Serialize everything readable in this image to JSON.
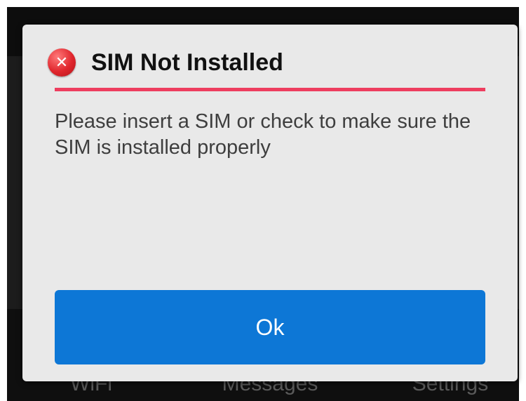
{
  "background_nav": {
    "items": [
      "WiFi",
      "Messages",
      "Settings"
    ]
  },
  "dialog": {
    "icon": "error-x-icon",
    "title": "SIM Not Installed",
    "message": "Please insert a SIM or check to make sure the SIM is installed properly",
    "ok_label": "Ok"
  },
  "colors": {
    "accent_divider": "#ee3e5f",
    "button": "#0d77d6",
    "error_icon": "#e0262d",
    "dialog_bg": "#e9e9e9"
  }
}
